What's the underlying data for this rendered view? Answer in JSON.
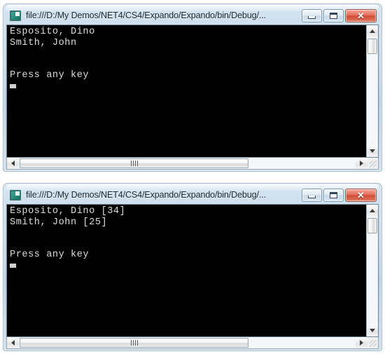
{
  "background_color": "#ffffff",
  "windows": [
    {
      "id": "console-window-1",
      "titlebar": {
        "icon": "console-app-icon",
        "title": "file:///D:/My Demos/NET4/CS4/Expando/Expando/bin/Debug/...",
        "buttons": {
          "minimize_label": "–",
          "maximize_label": "□",
          "close_label": "✕"
        }
      },
      "console": {
        "background_color": "#000000",
        "text_color": "#dcdcdc",
        "lines": [
          "Esposito, Dino",
          "Smith, John",
          "",
          "",
          "Press any key"
        ],
        "cursor": "block-caret"
      },
      "scrollbars": {
        "vertical": {
          "up_arrow": "arrow-up-icon",
          "down_arrow": "arrow-down-icon",
          "thumb_position_percent": 2,
          "thumb_size_percent": 13
        },
        "horizontal": {
          "left_arrow": "arrow-left-icon",
          "right_arrow": "arrow-right-icon",
          "thumb_position_percent": 0,
          "thumb_size_percent": 68,
          "grip": "grip-lines"
        },
        "resize_grip": "resize-grip-icon"
      }
    },
    {
      "id": "console-window-2",
      "titlebar": {
        "icon": "console-app-icon",
        "title": "file:///D:/My Demos/NET4/CS4/Expando/Expando/bin/Debug/...",
        "buttons": {
          "minimize_label": "–",
          "maximize_label": "□",
          "close_label": "✕"
        }
      },
      "console": {
        "background_color": "#000000",
        "text_color": "#dcdcdc",
        "lines": [
          "Esposito, Dino [34]",
          "Smith, John [25]",
          "",
          "",
          "Press any key"
        ],
        "cursor": "block-caret"
      },
      "scrollbars": {
        "vertical": {
          "up_arrow": "arrow-up-icon",
          "down_arrow": "arrow-down-icon",
          "thumb_position_percent": 2,
          "thumb_size_percent": 13
        },
        "horizontal": {
          "left_arrow": "arrow-left-icon",
          "right_arrow": "arrow-right-icon",
          "thumb_position_percent": 0,
          "thumb_size_percent": 68,
          "grip": "grip-lines"
        },
        "resize_grip": "resize-grip-icon"
      }
    }
  ],
  "colors": {
    "frame_top": "#d4e3f0",
    "frame_mid": "#b9d0e4",
    "frame_border": "#9fb8cd",
    "close_button": "#cf4a33",
    "console_bg": "#000000",
    "console_fg": "#dcdcdc",
    "scrollbar_track": "#f4f7f9"
  }
}
